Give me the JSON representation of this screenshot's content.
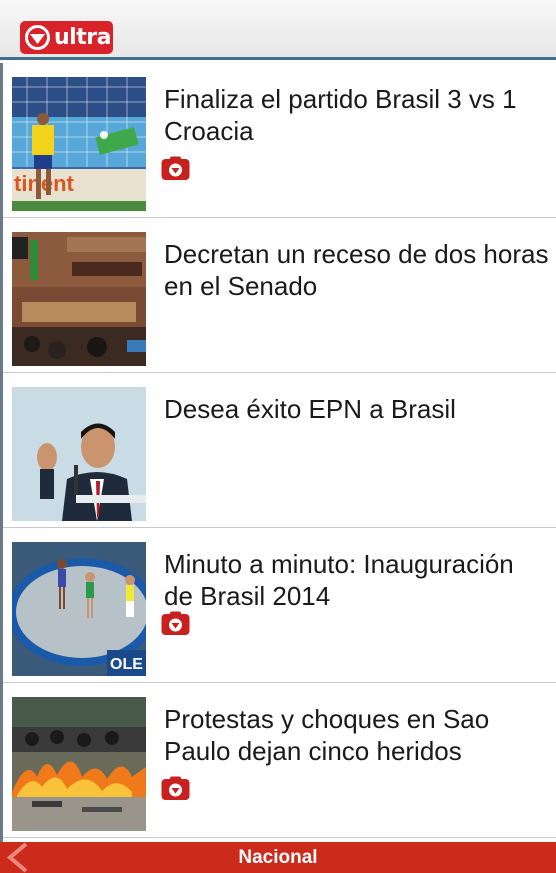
{
  "app": {
    "logo_text": "ultra",
    "brand_color": "#d8232a"
  },
  "feed": {
    "items": [
      {
        "headline": "Finaliza el partido Brasil 3 vs 1 Croacia",
        "has_media": true,
        "thumb": "soccer-goal-photo"
      },
      {
        "headline": "Decretan un receso de dos horas en el Senado",
        "has_media": false,
        "thumb": "senate-chamber-photo"
      },
      {
        "headline": "Desea éxito EPN a Brasil",
        "has_media": false,
        "thumb": "politician-speech-photo"
      },
      {
        "headline": "Minuto a minuto: Inauguración de Brasil 2014",
        "has_media": true,
        "thumb": "opening-ceremony-photo"
      },
      {
        "headline": "Protestas y choques en Sao Paulo dejan cinco heridos",
        "has_media": true,
        "thumb": "street-fire-photo"
      }
    ]
  },
  "bottom_bar": {
    "section_label": "Nacional",
    "color": "#cc2a1a"
  }
}
